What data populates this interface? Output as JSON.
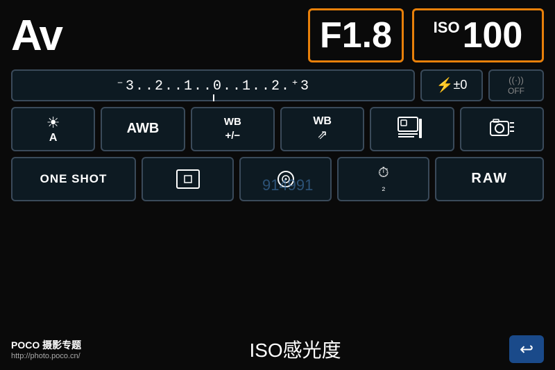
{
  "header": {
    "mode": "Av",
    "aperture": "F1.8",
    "iso_label": "ISO",
    "iso_value": "100"
  },
  "exposure": {
    "scale": "⁻3..2..1..0..1..2.⁺3",
    "flash_label": "⚡±0",
    "wifi_label": "((·))\nOFF"
  },
  "row3": {
    "scene": "☀A",
    "awb": "AWB",
    "wb_plus": "WB\n+/−",
    "wb_shift": "WB⇒",
    "picture_style": "⊞|",
    "camera_style": "📷≡"
  },
  "row4": {
    "one_shot": "ONE SHOT",
    "af_point": "⊡",
    "drive": "◎",
    "timer": "⏱₂",
    "raw": "RAW"
  },
  "bottom": {
    "poco": "POCO 摄影专题",
    "poco_url": "http://photo.poco.cn/",
    "iso_label": "ISO感光度",
    "back": "↩"
  },
  "watermark": "914991"
}
